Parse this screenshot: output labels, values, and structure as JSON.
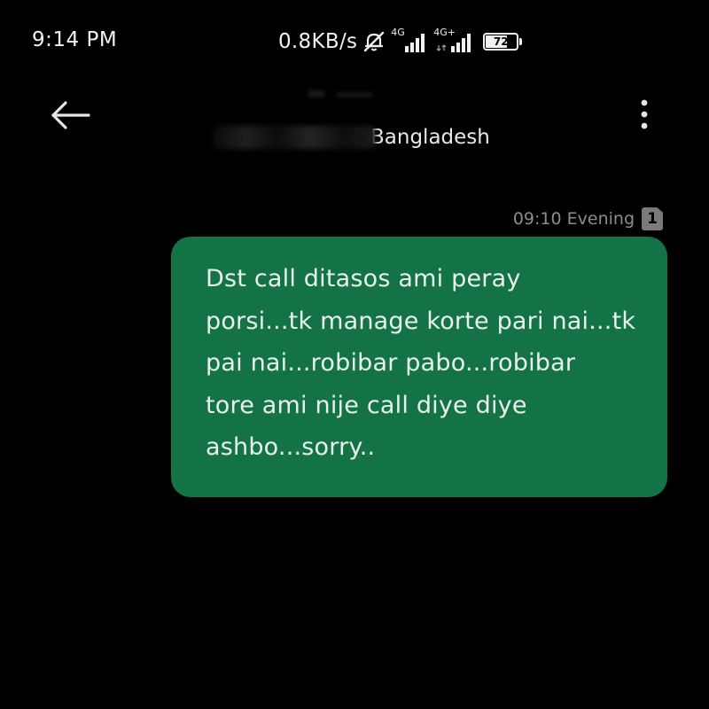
{
  "status_bar": {
    "time": "9:14 PM",
    "net_speed": "0.8KB/s",
    "mute_icon": "bell-off-icon",
    "sim1": {
      "network": "4G",
      "icon": "signal-icon",
      "bars": 4
    },
    "sim2": {
      "network": "4G+",
      "icon": "signal-icon",
      "bars": 4
    },
    "battery": {
      "level": 72,
      "label": "72",
      "icon": "battery-icon"
    }
  },
  "header": {
    "back_icon": "arrow-left-icon",
    "contact_location": "Bangladesh",
    "more_icon": "more-vertical-icon"
  },
  "conversation": {
    "timestamp": "09:10 Evening",
    "sim_badge": "1",
    "messages": [
      {
        "lines": [
          "Dst call ditasos ami peray",
          "porsi...tk manage korte pari nai...tk",
          "pai nai...robibar pabo...robibar",
          "tore ami nije call diye diye",
          "ashbo...sorry.."
        ]
      }
    ]
  },
  "colors": {
    "background": "#000000",
    "bubble": "#137347",
    "bubble_text": "#e9f1ec",
    "timestamp_text": "#8c8c8c"
  }
}
